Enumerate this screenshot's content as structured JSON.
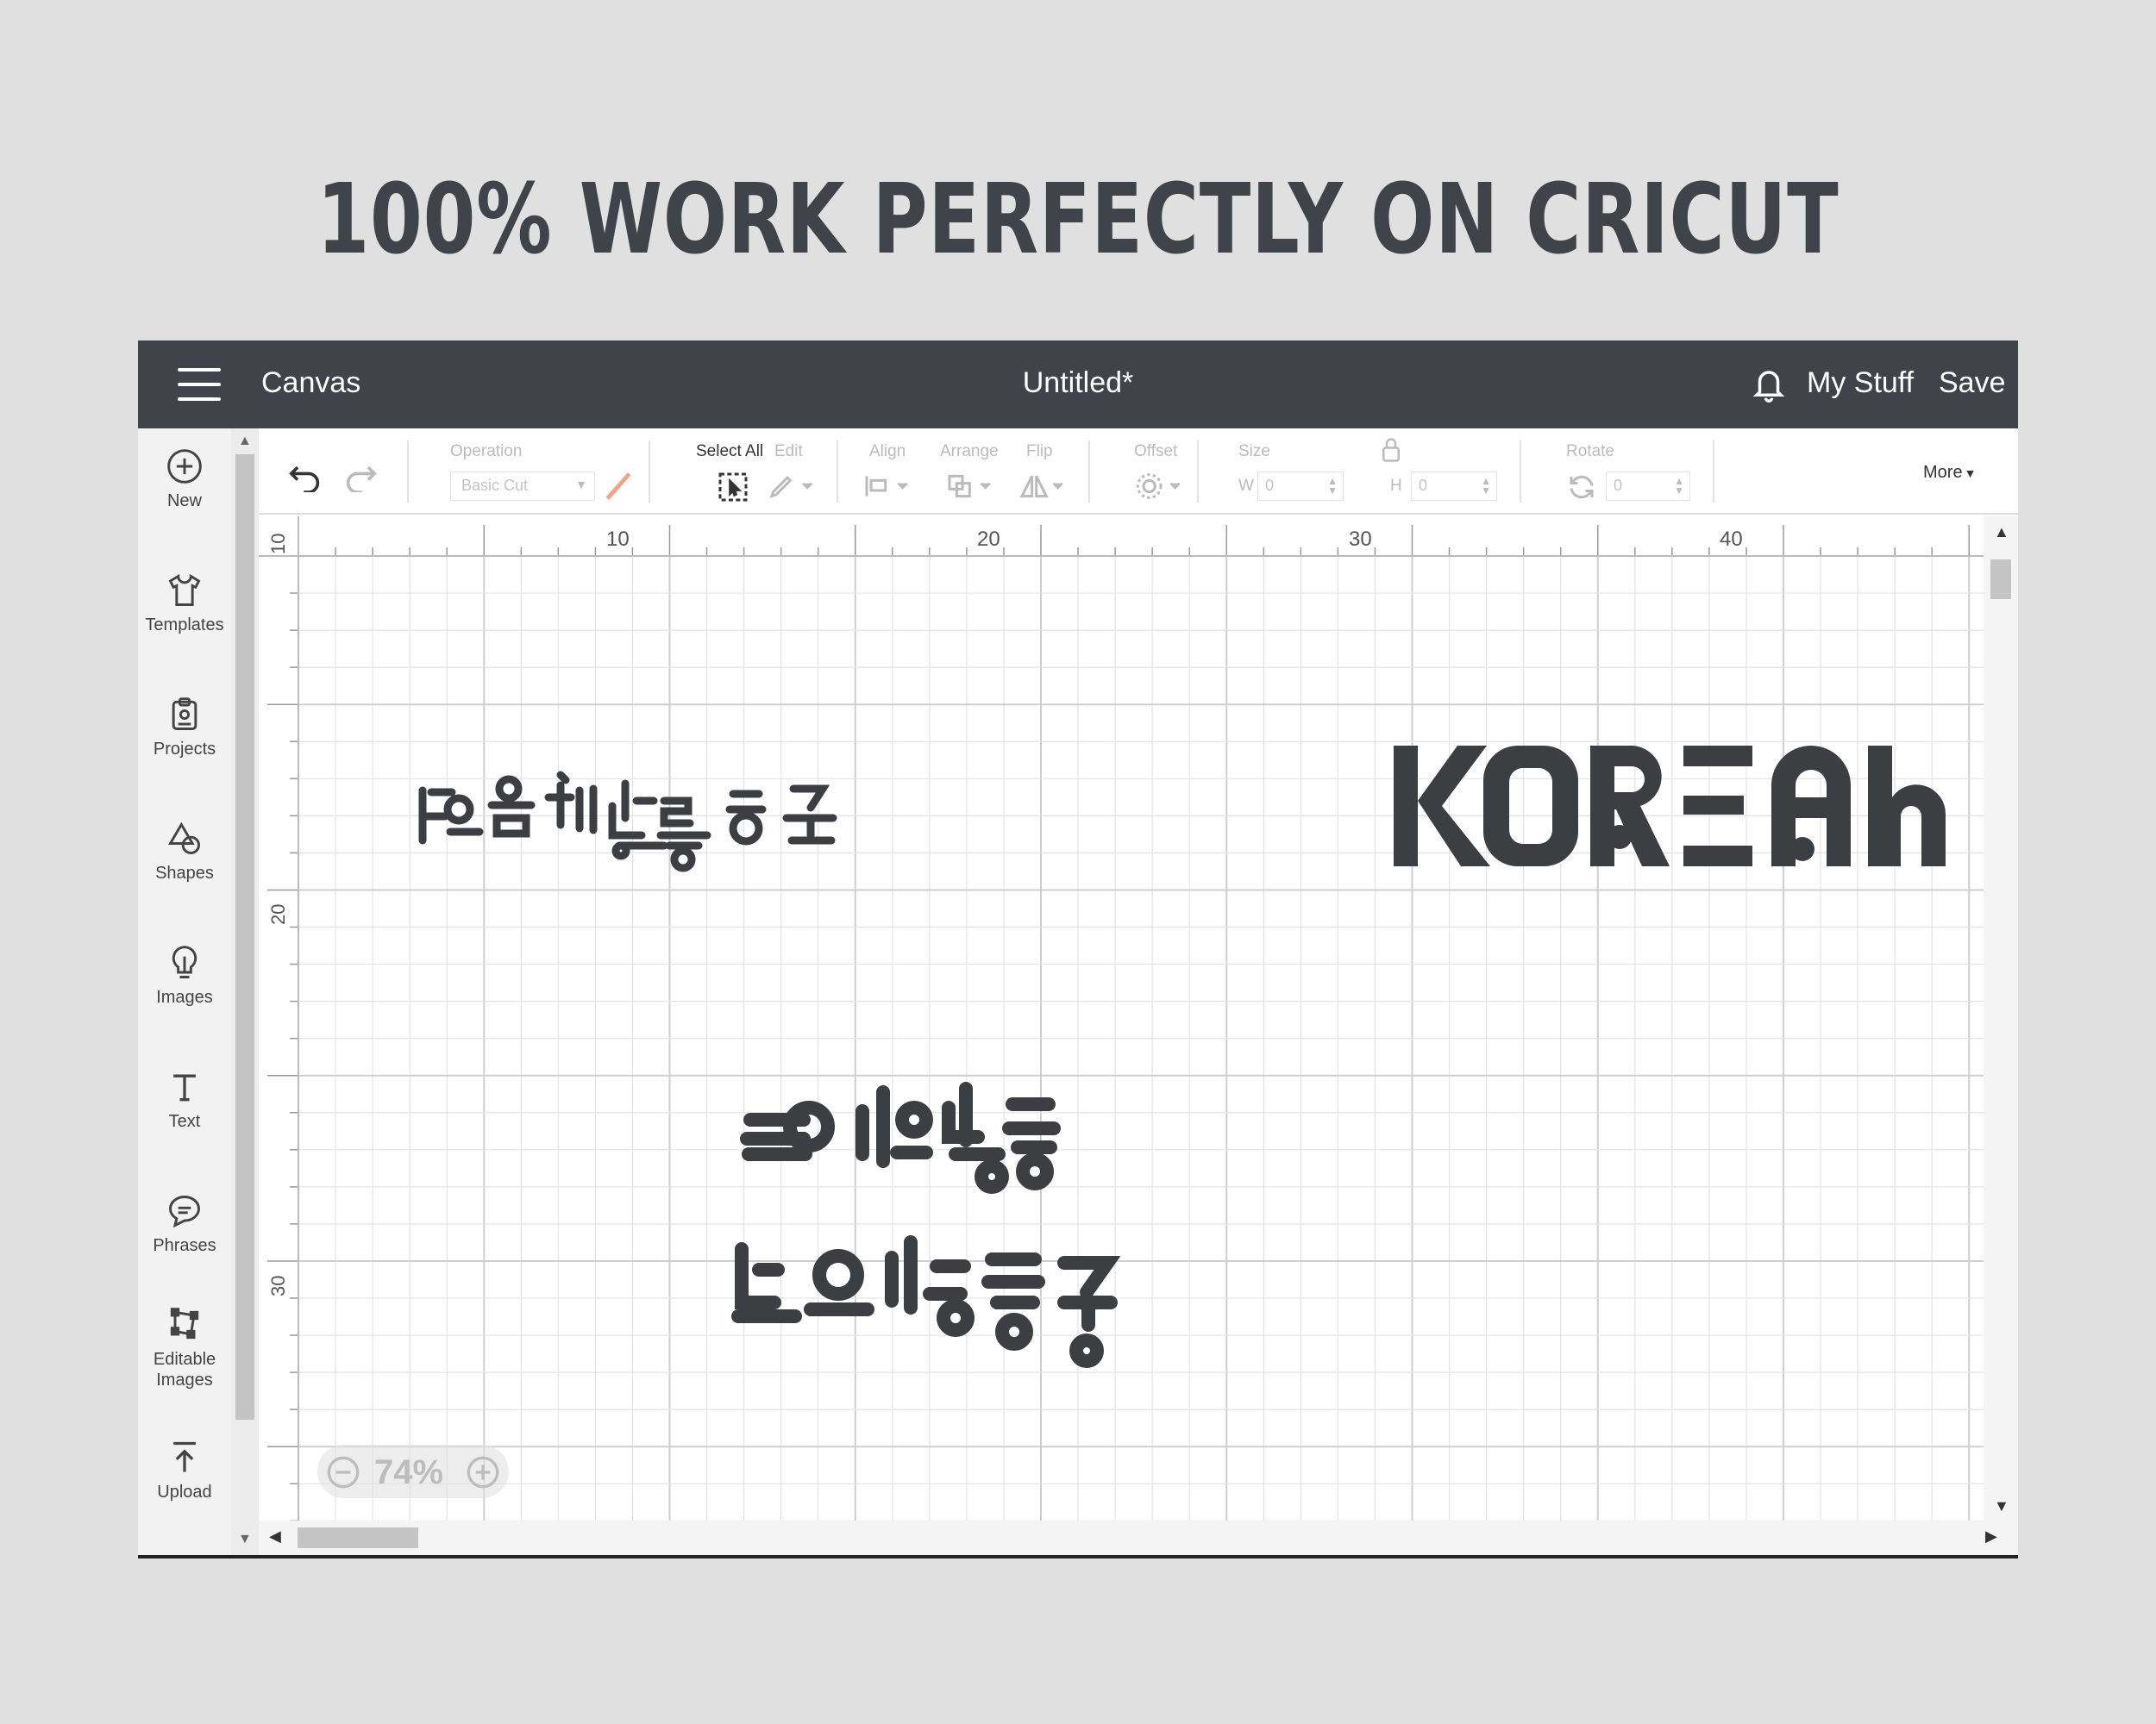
{
  "headline": "100% WORK PERFECTLY ON CRICUT",
  "topbar": {
    "app_name": "Canvas",
    "doc_title": "Untitled*",
    "mystuff": "My Stuff",
    "save": "Save"
  },
  "sidebar": {
    "items": [
      {
        "label": "New",
        "icon": "plus-circle-icon"
      },
      {
        "label": "Templates",
        "icon": "shirt-icon"
      },
      {
        "label": "Projects",
        "icon": "clipboard-icon"
      },
      {
        "label": "Shapes",
        "icon": "shapes-icon"
      },
      {
        "label": "Images",
        "icon": "lightbulb-icon"
      },
      {
        "label": "Text",
        "icon": "text-icon"
      },
      {
        "label": "Phrases",
        "icon": "speech-bubble-icon"
      },
      {
        "label": "Editable",
        "label2": "Images",
        "icon": "editable-images-icon"
      },
      {
        "label": "Upload",
        "icon": "upload-icon"
      }
    ]
  },
  "toolbar": {
    "operation_label": "Operation",
    "operation_value": "Basic Cut",
    "select_all": "Select All",
    "edit": "Edit",
    "align": "Align",
    "arrange": "Arrange",
    "flip": "Flip",
    "offset": "Offset",
    "size": "Size",
    "w_label": "W",
    "w_value": "0",
    "h_label": "H",
    "h_value": "0",
    "rotate": "Rotate",
    "rotate_value": "0",
    "more": "More"
  },
  "ruler": {
    "top": [
      "10",
      "20",
      "30",
      "40"
    ],
    "left": [
      "10",
      "20",
      "30"
    ]
  },
  "canvas_text": [
    "KOREAN"
  ],
  "zoom": {
    "value": "74%"
  },
  "colors": {
    "topbar": "#40444a",
    "glyph": "#3c3e42",
    "grid": "#e4e4e4",
    "grid_major": "#cfcfcf"
  }
}
